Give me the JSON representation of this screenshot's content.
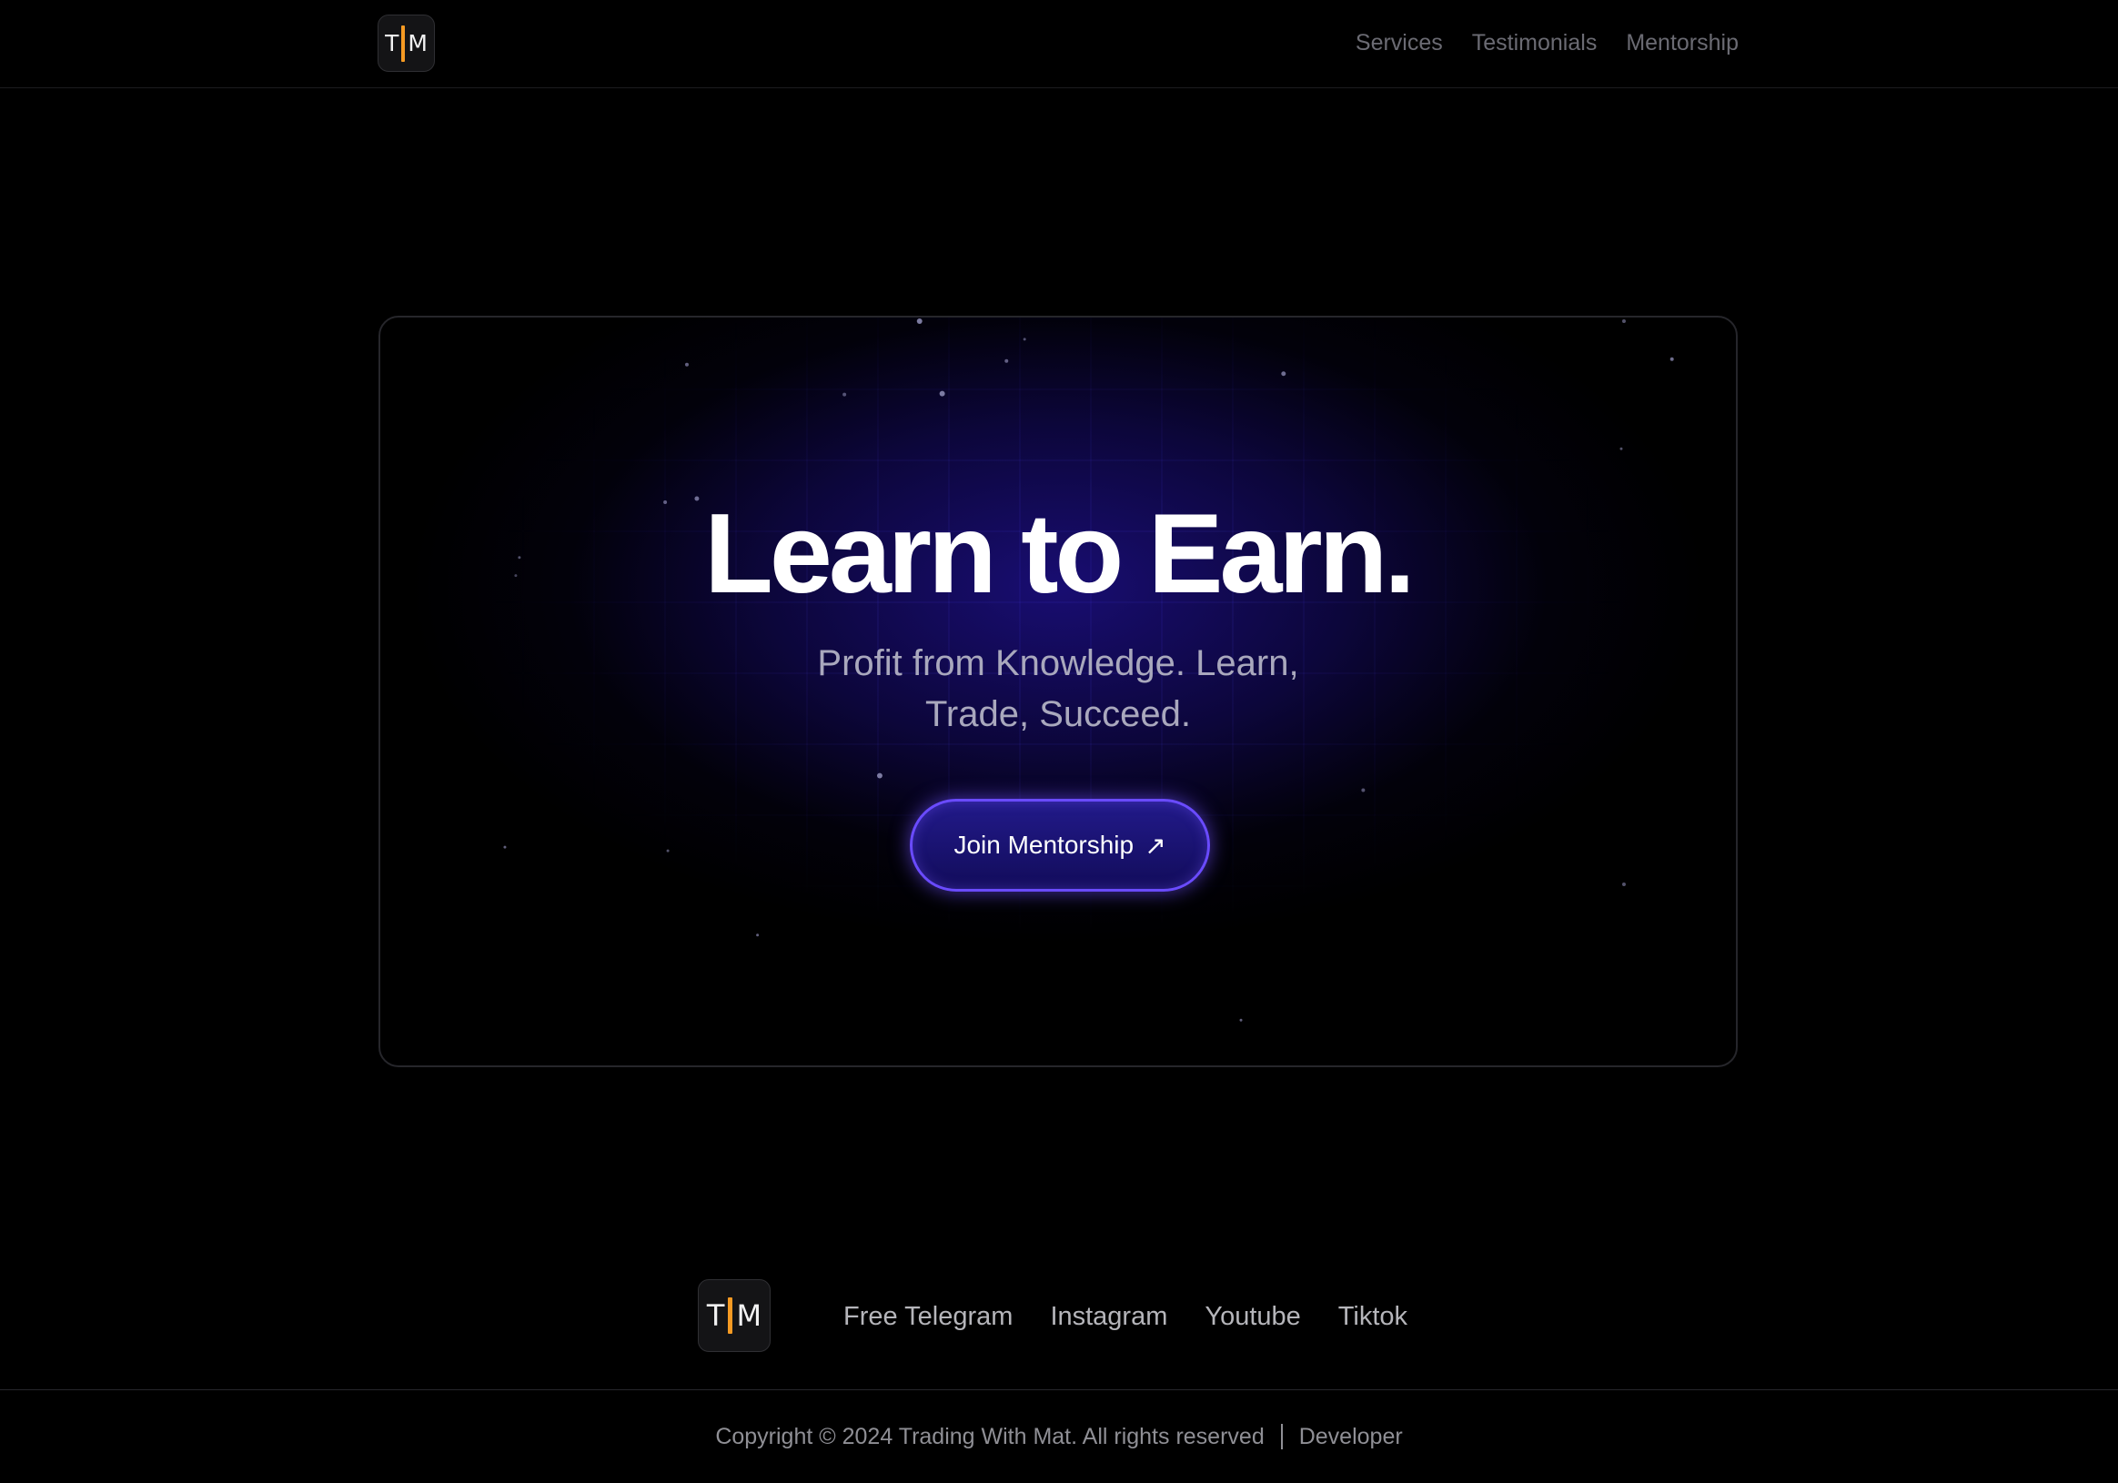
{
  "header": {
    "logo": {
      "left": "T",
      "right": "M"
    },
    "nav": [
      "Services",
      "Testimonials",
      "Mentorship"
    ]
  },
  "hero": {
    "title": "Learn to Earn.",
    "subtitle_line1": "Profit from Knowledge. Learn,",
    "subtitle_line2": "Trade, Succeed.",
    "cta_label": "Join Mentorship",
    "cta_icon": "arrow-up-right-icon"
  },
  "footer": {
    "logo": {
      "left": "T",
      "right": "M"
    },
    "links": [
      "Free Telegram",
      "Instagram",
      "Youtube",
      "Tiktok"
    ],
    "copyright": "Copyright © 2024 Trading With Mat. All rights reserved",
    "developer": "Developer"
  },
  "colors": {
    "background": "#000000",
    "accent_orange": "#f59a23",
    "cta_border": "#6a4bff",
    "glow": "#1a0e78"
  }
}
